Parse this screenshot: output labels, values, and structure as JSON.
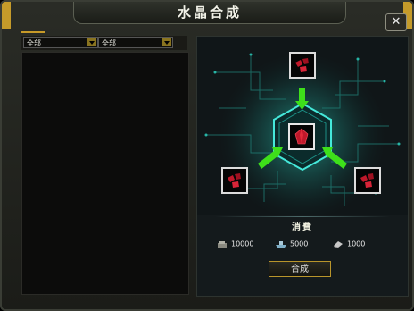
{
  "window": {
    "title": "水晶合成",
    "close_symbol": "✕"
  },
  "filters": {
    "filter1": "全部",
    "filter2": "全部"
  },
  "synthesis": {
    "cost_title": "消費",
    "costs": [
      {
        "icon": "gold-icon",
        "value": "10000"
      },
      {
        "icon": "ship-icon",
        "value": "5000"
      },
      {
        "icon": "steel-icon",
        "value": "1000"
      }
    ],
    "button_label": "合成"
  },
  "colors": {
    "accent": "#c79a28",
    "crystal": "#c0182a",
    "arrow": "#3ee01a",
    "circuit": "#1f7c74"
  }
}
